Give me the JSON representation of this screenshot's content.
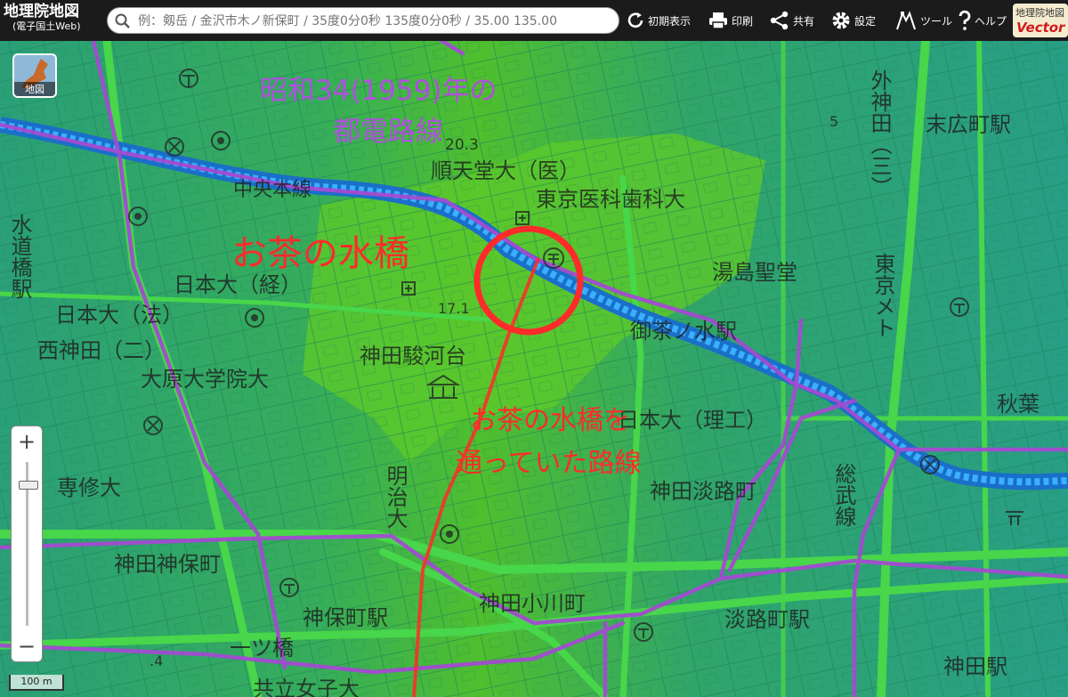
{
  "app": {
    "title": "地理院地図",
    "subtitle": "(電子国土Web)"
  },
  "search": {
    "placeholder": "例：剱岳 / 金沢市木ノ新保町 / 35度0分0秒 135度0分0秒 / 35.00 135.00"
  },
  "toolbar": {
    "initial_view": "初期表示",
    "print": "印刷",
    "share": "共有",
    "settings": "設定",
    "tools": "ツール",
    "help": "ヘルプ"
  },
  "vector_badge": {
    "line1": "地理院地図",
    "line2": "Vector"
  },
  "layer_button": {
    "label": "地図"
  },
  "zoom": {
    "plus": "+",
    "minus": "−",
    "level_fraction": 0.12
  },
  "scale": {
    "label": "100 m"
  },
  "colors": {
    "annotation_red": "#ff2a2a",
    "tram_purple": "#a34bd1",
    "road_green": "#3fd04a",
    "river_blue": "#1e8fe0"
  },
  "annotations": {
    "title_line1": "昭和34(1959)年の",
    "title_line2": "都電路線",
    "bridge_label": "お茶の水橋",
    "route_note_line1": "お茶の水橋を",
    "route_note_line2": "通っていた路線"
  },
  "map_labels": {
    "juntendo": "順天堂大（医）",
    "tmdu": "東京医科歯科大",
    "yushima": "湯島聖堂",
    "nihon_kei": "日本大（経）",
    "nihon_ho": "日本大（法）",
    "nishikanda": "西神田（二）",
    "ohara": "大原大学院大",
    "surugadai": "神田駿河台",
    "senshu": "専修大",
    "meiji": "明治大",
    "nihon_riko": "日本大（理工）",
    "awajicho": "神田淡路町",
    "jinbocho": "神田神保町",
    "ogawamachi": "神田小川町",
    "jinbocho_sta": "神保町駅",
    "awajicho_sta": "淡路町駅",
    "kanda_sta": "神田駅",
    "ochanomizu_sta": "御茶ノ水駅",
    "suehirocho_sta": "末広町駅",
    "akihabara": "秋葉",
    "suidobashi": "水道橋駅",
    "hitotsubashi": "一ツ橋",
    "kyoritsu": "共立女子大",
    "sotokanda": "外神田（三）",
    "tokyo_metro": "東京メト",
    "chuo_line": "中央本線",
    "sobu_line": "総武線",
    "elev_1": "20.3",
    "elev_2": "17.1",
    "elev_3": "5",
    "elev_4": ".4"
  }
}
